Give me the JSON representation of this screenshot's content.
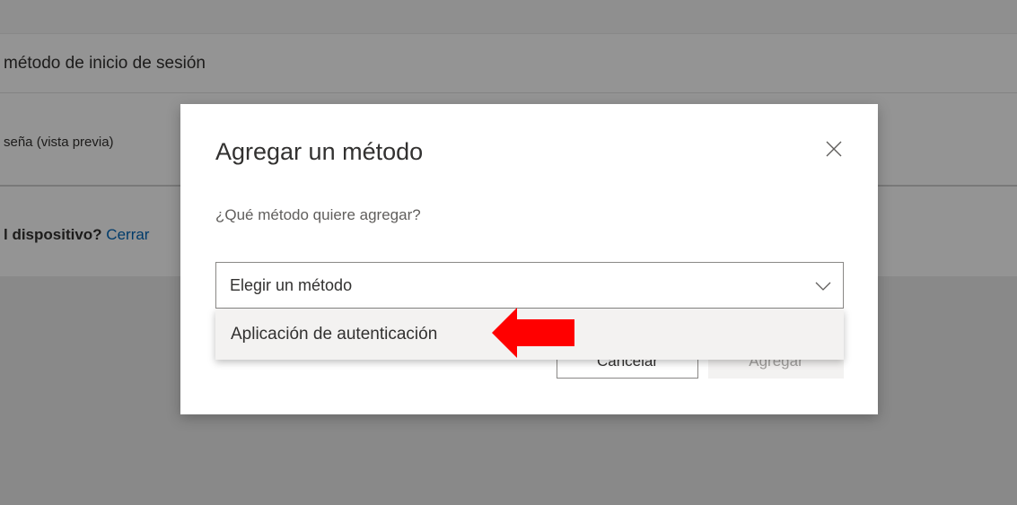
{
  "background": {
    "section_title": "método de inicio de sesión",
    "row_label": "seña (vista previa)",
    "device_question": "l dispositivo?",
    "device_link": "Cerrar"
  },
  "dialog": {
    "title": "Agregar un método",
    "question": "¿Qué método quiere agregar?",
    "select_placeholder": "Elegir un método",
    "options": [
      {
        "label": "Aplicación de autenticación"
      }
    ],
    "cancel_label": "Cancelar",
    "add_label": "Agregar"
  },
  "icons": {
    "close": "close-icon",
    "chevron": "chevron-down-icon",
    "annotation": "red-arrow-left"
  },
  "colors": {
    "link": "#0067b8",
    "annotation_arrow": "#ff0000",
    "border": "#8a8886"
  }
}
